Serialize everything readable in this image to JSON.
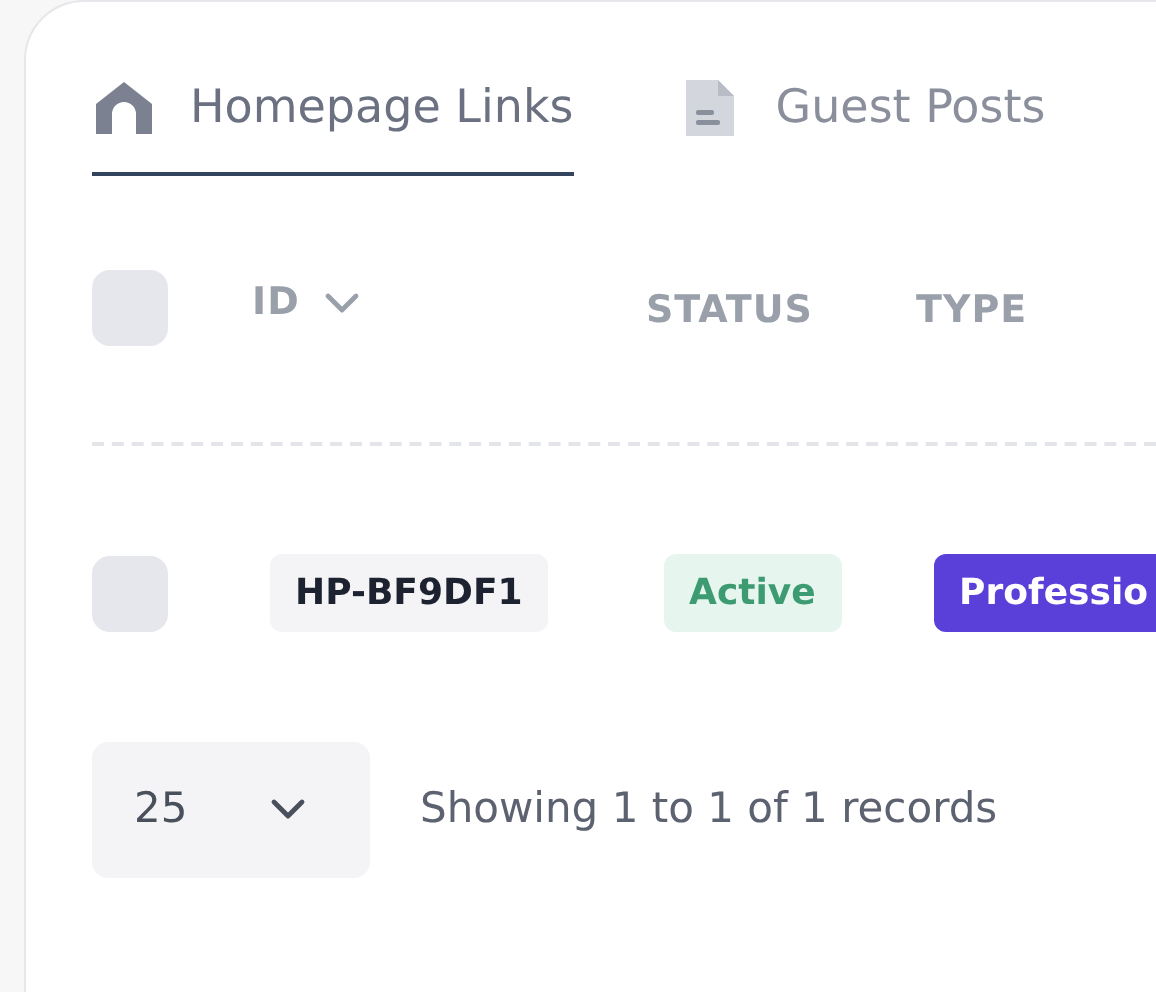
{
  "tabs": [
    {
      "label": "Homepage Links",
      "selected": true,
      "kind": "home"
    },
    {
      "label": "Guest Posts",
      "selected": false,
      "kind": "document"
    }
  ],
  "table": {
    "select_all": {
      "checked": false
    },
    "columns": [
      {
        "label": "ID",
        "sortable": true
      },
      {
        "label": "STATUS",
        "sortable": false
      },
      {
        "label": "TYPE",
        "sortable": false
      }
    ],
    "rows": [
      {
        "checked": false,
        "id": "HP-BF9DF1",
        "status": "Active",
        "type": "Professio"
      }
    ]
  },
  "footer": {
    "page_size": "25",
    "summary": "Showing 1 to 1 of 1 records"
  }
}
